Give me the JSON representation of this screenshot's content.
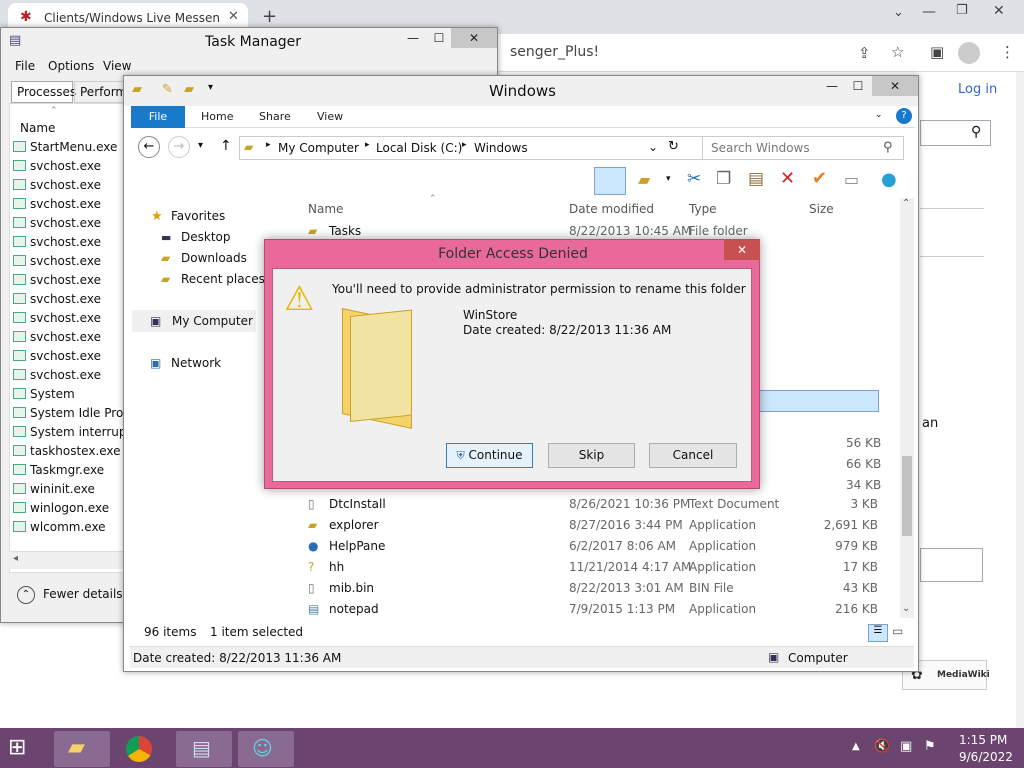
{
  "browser": {
    "tab_title": "Clients/Windows Live Messenger",
    "url_fragment": "senger_Plus!",
    "login": "Log in",
    "content_fragment": "an"
  },
  "taskmanager": {
    "title": "Task Manager",
    "menu": [
      "File",
      "Options",
      "View"
    ],
    "tabs": [
      "Processes",
      "Perform"
    ],
    "column": "Name",
    "processes": [
      "StartMenu.exe",
      "svchost.exe",
      "svchost.exe",
      "svchost.exe",
      "svchost.exe",
      "svchost.exe",
      "svchost.exe",
      "svchost.exe",
      "svchost.exe",
      "svchost.exe",
      "svchost.exe",
      "svchost.exe",
      "svchost.exe",
      "System",
      "System Idle Proce",
      "System interrupts",
      "taskhostex.exe",
      "Taskmgr.exe",
      "wininit.exe",
      "winlogon.exe",
      "wlcomm.exe"
    ],
    "fewer_details": "Fewer details"
  },
  "explorer": {
    "title": "Windows",
    "ribbon_tabs": [
      "File",
      "Home",
      "Share",
      "View"
    ],
    "breadcrumb": [
      "My Computer",
      "Local Disk (C:)",
      "Windows"
    ],
    "search_placeholder": "Search Windows",
    "nav": {
      "favorites": "Favorites",
      "desktop": "Desktop",
      "downloads": "Downloads",
      "recent": "Recent places",
      "my_computer": "My Computer",
      "network": "Network"
    },
    "columns": [
      "Name",
      "Date modified",
      "Type",
      "Size"
    ],
    "top_row": {
      "name": "Tasks",
      "date": "8/22/2013 10:45 AM",
      "type": "File folder",
      "size": ""
    },
    "hidden_sizes": [
      "56 KB",
      "66 KB",
      "34 KB"
    ],
    "rows": [
      {
        "name": "DtcInstall",
        "date": "8/26/2021 10:36 PM",
        "type": "Text Document",
        "size": "3 KB"
      },
      {
        "name": "explorer",
        "date": "8/27/2016 3:44 PM",
        "type": "Application",
        "size": "2,691 KB"
      },
      {
        "name": "HelpPane",
        "date": "6/2/2017 8:06 AM",
        "type": "Application",
        "size": "979 KB"
      },
      {
        "name": "hh",
        "date": "11/21/2014 4:17 AM",
        "type": "Application",
        "size": "17 KB"
      },
      {
        "name": "mib.bin",
        "date": "8/22/2013 3:01 AM",
        "type": "BIN File",
        "size": "43 KB"
      },
      {
        "name": "notepad",
        "date": "7/9/2015 1:13 PM",
        "type": "Application",
        "size": "216 KB"
      }
    ],
    "status_items": "96 items",
    "status_selected": "1 item selected",
    "details_left": "Date created: 8/22/2013 11:36 AM",
    "details_right": "Computer"
  },
  "dialog": {
    "title": "Folder Access Denied",
    "message": "You'll need to provide administrator permission to rename this folder",
    "folder_name": "WinStore",
    "folder_date": "Date created: 8/22/2013 11:36 AM",
    "continue": "Continue",
    "skip": "Skip",
    "cancel": "Cancel"
  },
  "taskbar": {
    "time": "1:15 PM",
    "date": "9/6/2022"
  },
  "colors": {
    "dialog_frame": "#e8699a",
    "taskbar": "#6b4570",
    "ribbon_file": "#1979ca",
    "selection": "#cce8ff"
  }
}
